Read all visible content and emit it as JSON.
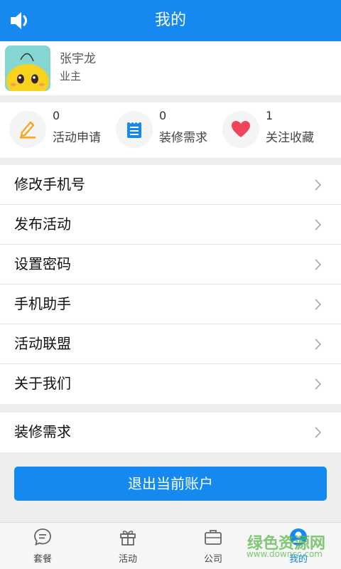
{
  "header": {
    "title": "我的",
    "icon": "speaker-icon"
  },
  "profile": {
    "name": "张宇龙",
    "role": "业主"
  },
  "stats": [
    {
      "count": "0",
      "label": "活动申请",
      "icon": "pencil-icon"
    },
    {
      "count": "0",
      "label": "装修需求",
      "icon": "notepad-icon"
    },
    {
      "count": "1",
      "label": "关注收藏",
      "icon": "heart-icon"
    }
  ],
  "menu": [
    {
      "label": "修改手机号"
    },
    {
      "label": "发布活动"
    },
    {
      "label": "设置密码"
    },
    {
      "label": "手机助手"
    },
    {
      "label": "活动联盟"
    },
    {
      "label": "关于我们"
    }
  ],
  "menu2": [
    {
      "label": "装修需求"
    }
  ],
  "logout_label": "退出当前账户",
  "tabs": [
    {
      "label": "套餐",
      "icon": "chat-bubble-icon"
    },
    {
      "label": "活动",
      "icon": "gift-icon"
    },
    {
      "label": "公司",
      "icon": "briefcase-icon"
    },
    {
      "label": "我的",
      "icon": "user-icon",
      "active": true
    }
  ],
  "watermark": {
    "text": "绿色资源网",
    "url_text": "www.downcc.com"
  },
  "colors": {
    "primary": "#1589f0",
    "accent_orange": "#f5a623",
    "heart_red": "#f0445a"
  }
}
